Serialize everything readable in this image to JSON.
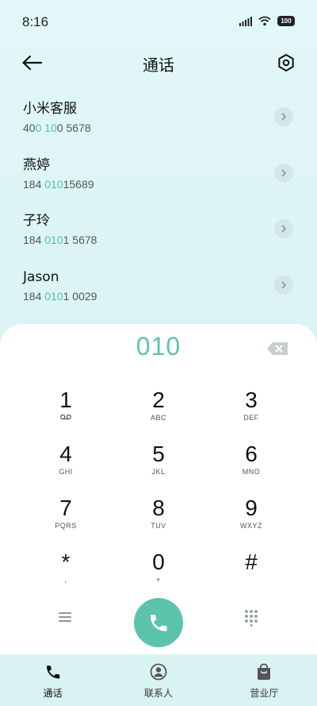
{
  "status_bar": {
    "time": "8:16",
    "battery": "100"
  },
  "header": {
    "title": "通话"
  },
  "dialed": "010",
  "contacts": [
    {
      "name": "小米客服",
      "number_parts": [
        "40",
        "0",
        " ",
        "10",
        "0 5678"
      ]
    },
    {
      "name": "燕婷",
      "number_parts": [
        "184 ",
        "010",
        "15689",
        "",
        ""
      ]
    },
    {
      "name": "子玲",
      "number_parts": [
        "184 ",
        "010",
        "1 5678",
        "",
        ""
      ]
    },
    {
      "name": "Jason",
      "number_parts": [
        "184 ",
        "010",
        "1 0029",
        "",
        ""
      ]
    }
  ],
  "keys": [
    {
      "digit": "1",
      "letters": ""
    },
    {
      "digit": "2",
      "letters": "ABC"
    },
    {
      "digit": "3",
      "letters": "DEF"
    },
    {
      "digit": "4",
      "letters": "GHI"
    },
    {
      "digit": "5",
      "letters": "JKL"
    },
    {
      "digit": "6",
      "letters": "MNO"
    },
    {
      "digit": "7",
      "letters": "PQRS"
    },
    {
      "digit": "8",
      "letters": "TUV"
    },
    {
      "digit": "9",
      "letters": "WXYZ"
    },
    {
      "digit": "*",
      "letters": ","
    },
    {
      "digit": "0",
      "letters": "+"
    },
    {
      "digit": "#",
      "letters": ""
    }
  ],
  "nav": [
    {
      "label": "通话",
      "icon": "phone-icon"
    },
    {
      "label": "联系人",
      "icon": "contact-icon"
    },
    {
      "label": "营业厅",
      "icon": "store-bag-icon"
    }
  ],
  "colors": {
    "accent": "#5cc4ad",
    "nav_bg": "#d8f3f1"
  }
}
